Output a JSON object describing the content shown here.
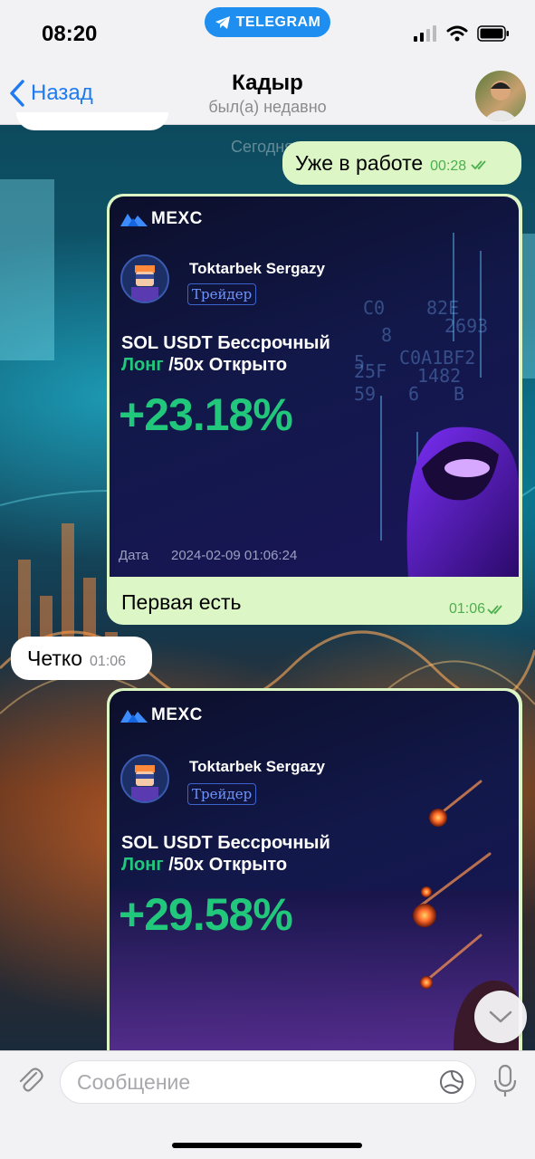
{
  "status_bar": {
    "time": "08:20",
    "app_pill": "TELEGRAM"
  },
  "header": {
    "back_label": "Назад",
    "contact_name": "Кадыр",
    "last_seen": "был(а) недавно"
  },
  "date_divider": "Сегодня",
  "messages": [
    {
      "text": "Уже в работе",
      "time": "00:28",
      "outgoing": true
    },
    {
      "card": {
        "brand": "MEXC",
        "trader_name": "Toktarbek Sergazy",
        "trader_badge": "Трейдер",
        "pair_line": "SOL USDT Бессрочный",
        "side": "Лонг",
        "leverage_line": "/50x Открыто",
        "pnl": "+23.18%",
        "date_label": "Дата",
        "date_value": "2024-02-09 01:06:24"
      },
      "caption": "Первая есть",
      "time": "01:06",
      "outgoing": true
    },
    {
      "text": "Четко",
      "time": "01:06",
      "outgoing": false
    },
    {
      "card": {
        "brand": "MEXC",
        "trader_name": "Toktarbek Sergazy",
        "trader_badge": "Трейдер",
        "pair_line": "SOL USDT Бессрочный",
        "side": "Лонг",
        "leverage_line": "/50x Открыто",
        "pnl": "+29.58%"
      },
      "outgoing": true
    }
  ],
  "composer": {
    "placeholder": "Сообщение"
  },
  "colors": {
    "accent": "#1e7bf0",
    "outgoing_bubble": "#dcf7c5",
    "pnl_green": "#21c77a"
  },
  "icons": [
    "telegram-icon",
    "signal-icon",
    "wifi-icon",
    "battery-icon",
    "chevron-left-icon",
    "double-check-icon",
    "mexc-logo-icon",
    "paperclip-icon",
    "sticker-icon",
    "microphone-icon",
    "chevron-down-icon"
  ]
}
